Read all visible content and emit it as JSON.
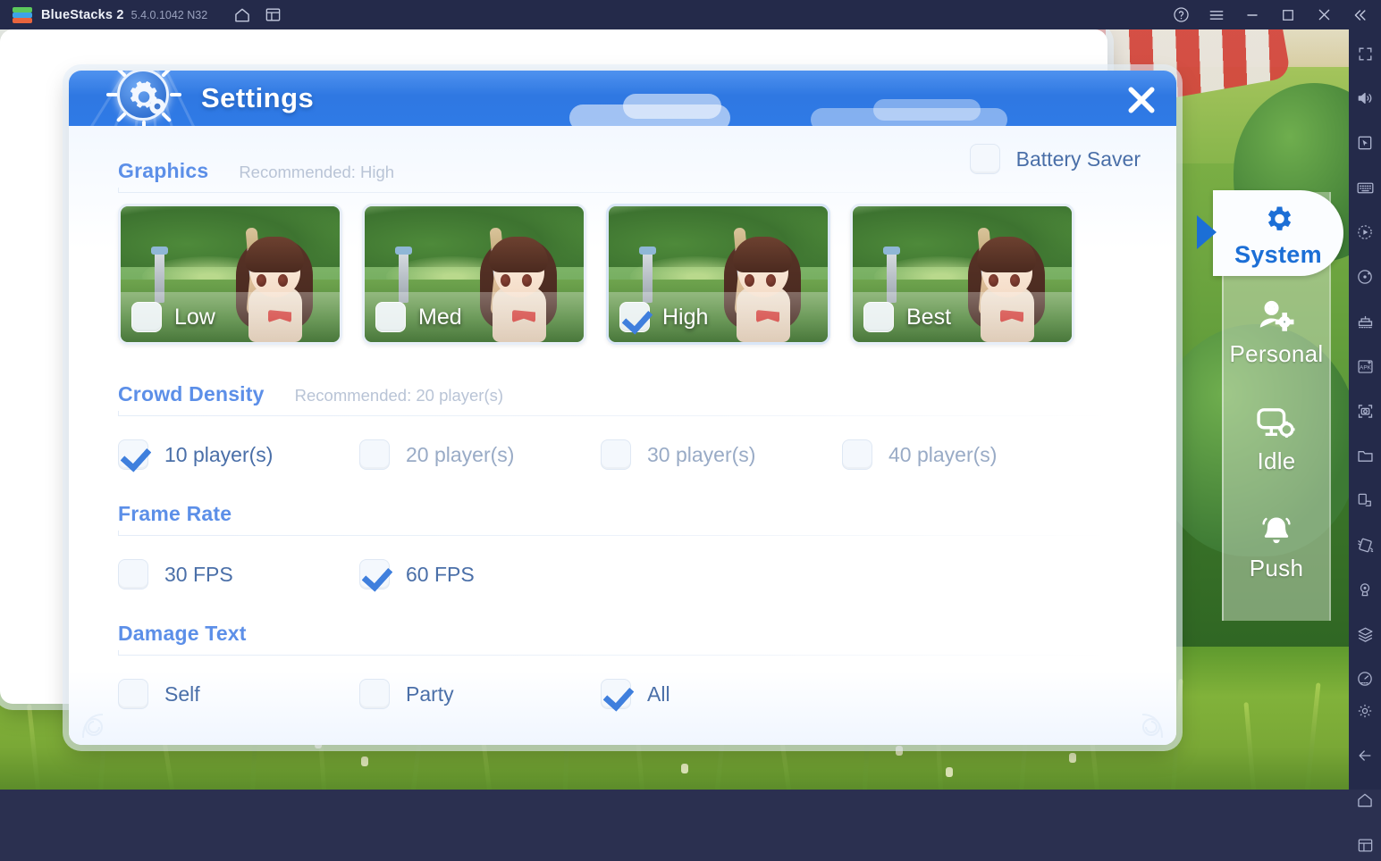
{
  "titlebar": {
    "app_name": "BlueStacks 2",
    "version": "5.4.0.1042 N32",
    "left_icons": [
      {
        "name": "home-icon",
        "label": "Home"
      },
      {
        "name": "multi-instance-icon",
        "label": "Multi-instance"
      }
    ],
    "right_icons": [
      {
        "name": "help-icon",
        "label": "Help"
      },
      {
        "name": "menu-icon",
        "label": "Menu"
      },
      {
        "name": "minimize-icon",
        "label": "Minimize"
      },
      {
        "name": "maximize-icon",
        "label": "Maximize"
      },
      {
        "name": "close-icon",
        "label": "Close"
      },
      {
        "name": "collapse-sidebar-icon",
        "label": "Collapse"
      }
    ]
  },
  "toolbar": {
    "items": [
      {
        "name": "fullscreen-icon",
        "label": "Fullscreen"
      },
      {
        "name": "volume-icon",
        "label": "Volume"
      },
      {
        "name": "cursor-icon",
        "label": "Pointer"
      },
      {
        "name": "keyboard-icon",
        "label": "Keymapping"
      },
      {
        "name": "macro-record-icon",
        "label": "Macro recorder"
      },
      {
        "name": "rotate-icon",
        "label": "Rotate"
      },
      {
        "name": "multi-instance-sync-icon",
        "label": "Instance sync"
      },
      {
        "name": "install-apk-icon",
        "label": "Install APK"
      },
      {
        "name": "screenshot-icon",
        "label": "Screenshot"
      },
      {
        "name": "media-folder-icon",
        "label": "Media manager"
      },
      {
        "name": "shake-icon",
        "label": "Shake"
      },
      {
        "name": "tilt-icon",
        "label": "Tilt"
      },
      {
        "name": "location-icon",
        "label": "Location"
      },
      {
        "name": "layers-icon",
        "label": "Layers"
      },
      {
        "name": "performance-icon",
        "label": "Performance"
      }
    ],
    "bottom_items": [
      {
        "name": "settings-gear-icon",
        "label": "Settings"
      },
      {
        "name": "back-arrow-icon",
        "label": "Back"
      },
      {
        "name": "home-icon",
        "label": "Home"
      },
      {
        "name": "recent-apps-icon",
        "label": "Recent apps"
      }
    ]
  },
  "game_menu": {
    "items": [
      {
        "name": "system",
        "label": "System",
        "icon": "gear-icon",
        "active": true
      },
      {
        "name": "personal",
        "label": "Personal",
        "icon": "person-gear-icon",
        "active": false
      },
      {
        "name": "idle",
        "label": "Idle",
        "icon": "monitor-gear-icon",
        "active": false
      },
      {
        "name": "push",
        "label": "Push",
        "icon": "bell-icon",
        "active": false
      }
    ]
  },
  "dialog": {
    "title": "Settings",
    "close_label": "Close",
    "battery_saver": {
      "label": "Battery Saver",
      "checked": false
    },
    "sections": [
      {
        "key": "graphics",
        "title": "Graphics",
        "hint": "Recommended: High",
        "options": [
          {
            "label": "Low",
            "checked": false
          },
          {
            "label": "Med",
            "checked": false
          },
          {
            "label": "High",
            "checked": true
          },
          {
            "label": "Best",
            "checked": false
          }
        ]
      },
      {
        "key": "crowd_density",
        "title": "Crowd Density",
        "hint": "Recommended: 20 player(s)",
        "options": [
          {
            "label": "10 player(s)",
            "checked": true
          },
          {
            "label": "20 player(s)",
            "checked": false
          },
          {
            "label": "30 player(s)",
            "checked": false
          },
          {
            "label": "40 player(s)",
            "checked": false
          }
        ]
      },
      {
        "key": "frame_rate",
        "title": "Frame Rate",
        "hint": "",
        "options": [
          {
            "label": "30 FPS",
            "checked": false
          },
          {
            "label": "60 FPS",
            "checked": true
          }
        ]
      },
      {
        "key": "damage_text",
        "title": "Damage Text",
        "hint": "",
        "options": [
          {
            "label": "Self",
            "checked": false
          },
          {
            "label": "Party",
            "checked": false
          },
          {
            "label": "All",
            "checked": true
          }
        ]
      }
    ]
  },
  "colors": {
    "accent_blue": "#3f7fdd",
    "section_title": "#5c8fe8",
    "hint_gray": "#b9c4d6",
    "option_text": "#4a6fa8",
    "header_blue": "#2f78e2",
    "titlebar_bg": "#242a4a"
  }
}
